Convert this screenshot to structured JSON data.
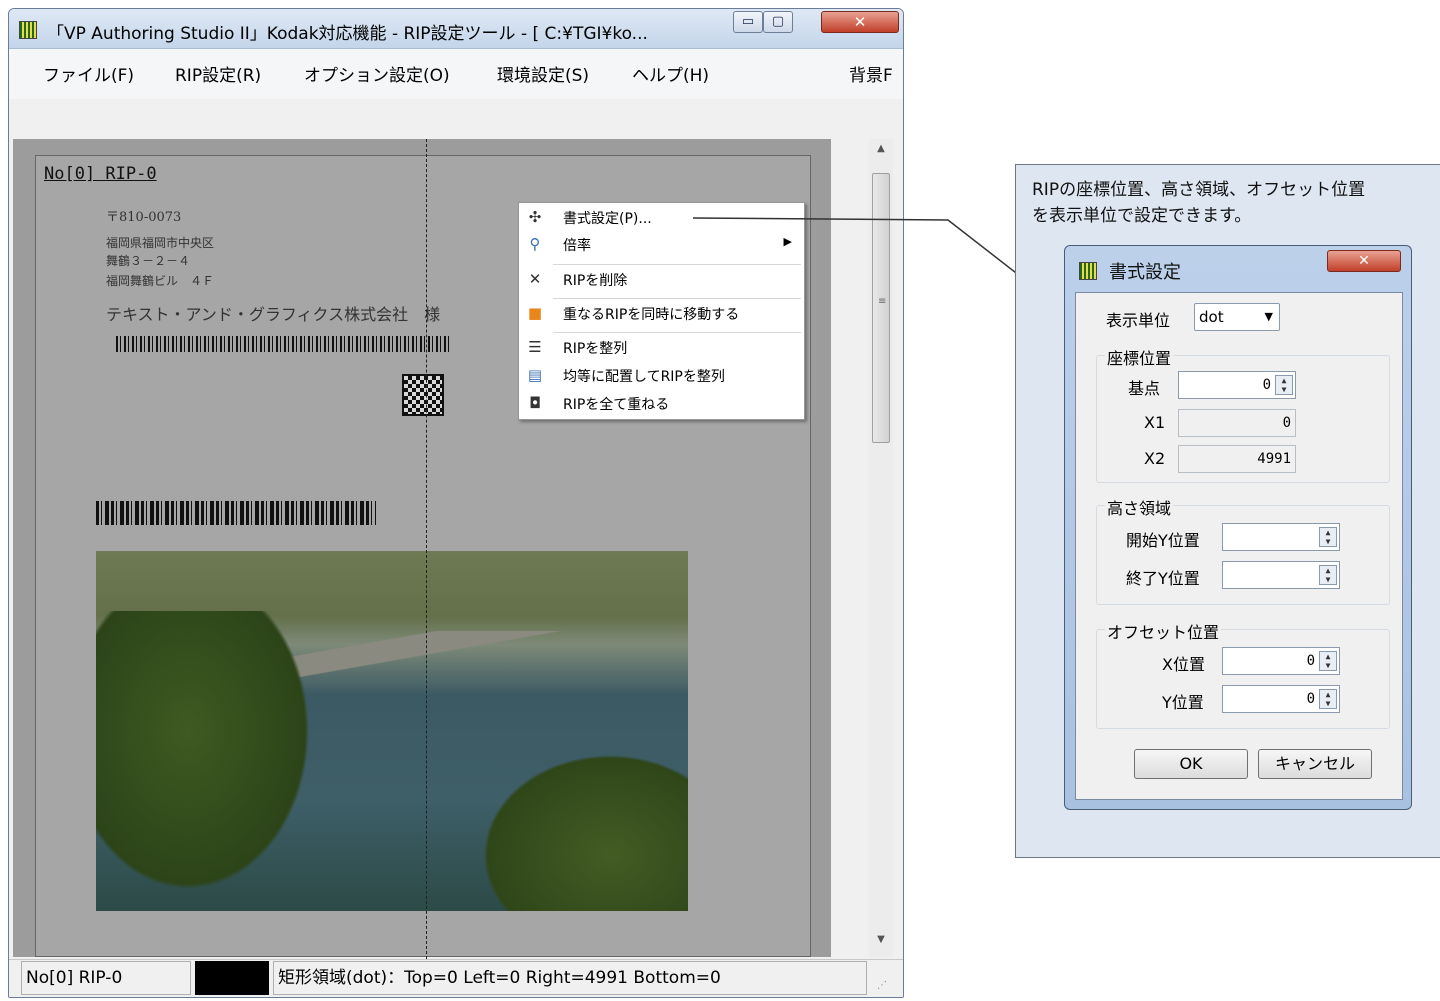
{
  "window": {
    "title": "「VP Authoring Studio II」Kodak対応機能 - RIP設定ツール - [ C:¥TGI¥ko...",
    "min_glyph": "▭",
    "max_glyph": "▢",
    "close_glyph": "✕"
  },
  "menu": {
    "file": "ファイル(F)",
    "rip": "RIP設定(R)",
    "option": "オプション設定(O)",
    "env": "環境設定(S)",
    "help": "ヘルプ(H)",
    "bg": "背景F"
  },
  "document": {
    "rip_label": "No[0] RIP-0",
    "zip": "〒810-0073",
    "addr_1": "福岡県福岡市中央区",
    "addr_2": "舞鶴３－２－４",
    "addr_3": "福岡舞鶴ビル　４Ｆ",
    "company": "テキスト・アンド・グラフィクス株式会社　様"
  },
  "context_menu": {
    "format": "書式設定(P)...",
    "zoom": "倍率",
    "delete": "RIPを削除",
    "move_overlap": "重なるRIPを同時に移動する",
    "align": "RIPを整列",
    "align_even": "均等に配置してRIPを整列",
    "stack_all": "RIPを全て重ねる",
    "icons": {
      "format": "move-cross-icon",
      "zoom": "magnifier-icon",
      "delete": "close-icon",
      "move": "overlap-squares-icon",
      "align": "align-lines-icon",
      "align_even": "distribute-icon",
      "stack": "stack-icon"
    }
  },
  "status": {
    "name": "No[0] RIP-0",
    "rect": "矩形領域(dot)：Top=0 Left=0 Right=4991 Bottom=0"
  },
  "callout": {
    "line_1": "RIPの座標位置、高さ領域、オフセット位置",
    "line_2": "を表示単位で設定できます。"
  },
  "dialog": {
    "title": "書式設定",
    "close": "✕",
    "unit_label": "表示単位",
    "unit_value": "dot",
    "coord_group": "座標位置",
    "base_label": "基点",
    "base_value": "0",
    "x1_label": "X1",
    "x1_value": "0",
    "x2_label": "X2",
    "x2_value": "4991",
    "height_group": "高さ領域",
    "start_y_label": "開始Y位置",
    "start_y_value": "",
    "end_y_label": "終了Y位置",
    "end_y_value": "",
    "offset_group": "オフセット位置",
    "x_pos_label": "X位置",
    "x_pos_value": "0",
    "y_pos_label": "Y位置",
    "y_pos_value": "0",
    "ok": "OK",
    "cancel": "キャンセル"
  },
  "colors": {
    "accent": "#c1402b",
    "canvas": "#9c9c9c",
    "callout_bg": "#dde6f1"
  }
}
